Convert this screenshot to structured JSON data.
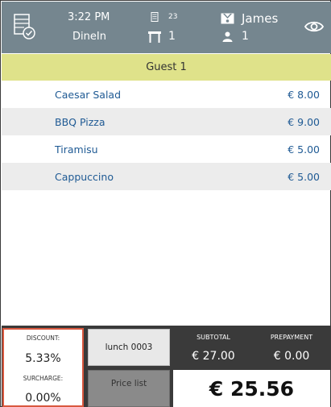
{
  "header": {
    "time": "3:22 PM",
    "order_type": "DineIn",
    "receipt_number": "23",
    "table_number": "1",
    "waiter": "James",
    "guests": "1",
    "icons": {
      "order": "order-list-check-icon",
      "receipt": "receipt-icon",
      "table": "table-icon",
      "waiter": "waiter-icon",
      "guests": "person-icon",
      "view": "eye-icon"
    }
  },
  "guest_bar": {
    "label": "Guest 1"
  },
  "items": [
    {
      "name": "Caesar Salad",
      "price": "€ 8.00"
    },
    {
      "name": "BBQ Pizza",
      "price": "€ 9.00"
    },
    {
      "name": "Tiramisu",
      "price": "€ 5.00"
    },
    {
      "name": "Cappuccino",
      "price": "€ 5.00"
    }
  ],
  "bottom": {
    "discount_label": "DISCOUNT:",
    "discount_value": "5.33%",
    "surcharge_label": "SURCHARGE:",
    "surcharge_value": "0.00%",
    "lunch_button": "lunch 0003",
    "pricelist_button": "Price list",
    "subtotal_label": "SUBTOTAL",
    "subtotal_value": "€ 27.00",
    "prepayment_label": "PREPAYMENT",
    "prepayment_value": "€ 0.00",
    "total_value": "€ 25.56"
  },
  "colors": {
    "header_bg": "#75868f",
    "guest_bar_bg": "#dfe28a",
    "item_text": "#1f5a94",
    "discount_border": "#d9583f",
    "bottom_bg": "#3a3a3a"
  }
}
